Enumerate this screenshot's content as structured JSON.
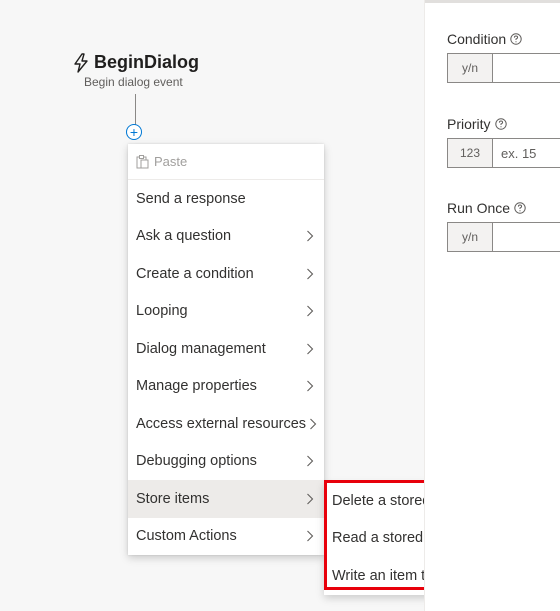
{
  "trigger": {
    "title": "BeginDialog",
    "subtitle": "Begin dialog event"
  },
  "add_button": {
    "symbol": "+"
  },
  "menu": {
    "paste_label": "Paste",
    "items": [
      {
        "label": "Send a response",
        "has_submenu": false
      },
      {
        "label": "Ask a question",
        "has_submenu": true
      },
      {
        "label": "Create a condition",
        "has_submenu": true
      },
      {
        "label": "Looping",
        "has_submenu": true
      },
      {
        "label": "Dialog management",
        "has_submenu": true
      },
      {
        "label": "Manage properties",
        "has_submenu": true
      },
      {
        "label": "Access external resources",
        "has_submenu": true
      },
      {
        "label": "Debugging options",
        "has_submenu": true
      },
      {
        "label": "Store items",
        "has_submenu": true
      },
      {
        "label": "Custom Actions",
        "has_submenu": true
      }
    ]
  },
  "submenu": {
    "items": [
      {
        "label": "Delete a stored item"
      },
      {
        "label": "Read a stored item"
      },
      {
        "label": "Write an item to storage"
      }
    ]
  },
  "panel": {
    "condition": {
      "label": "Condition",
      "type": "y/n",
      "value": "",
      "placeholder": ""
    },
    "priority": {
      "label": "Priority",
      "type": "123",
      "value": "",
      "placeholder": "ex. 15"
    },
    "run_once": {
      "label": "Run Once",
      "type": "y/n",
      "value": "",
      "placeholder": ""
    }
  },
  "colors": {
    "accent": "#0078d4",
    "highlight_border": "#e8000b",
    "menu_active_bg": "#edebe9"
  }
}
